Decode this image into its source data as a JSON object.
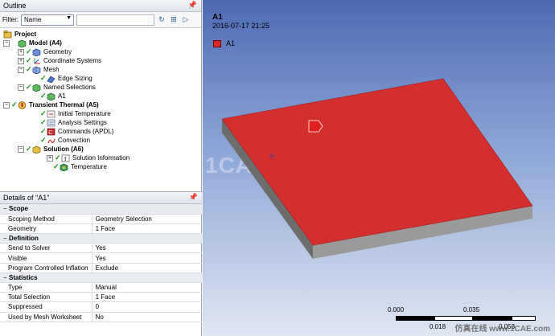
{
  "outline": {
    "title": "Outline",
    "pin": "ё",
    "filter_label": "Filter:",
    "filter_value": "Name",
    "filter_text": "",
    "tree": [
      {
        "label": "Project",
        "bold": true
      },
      {
        "label": "Model (A4)",
        "bold": true
      },
      {
        "label": "Geometry",
        "bold": false
      },
      {
        "label": "Coordinate Systems",
        "bold": false
      },
      {
        "label": "Mesh",
        "bold": false
      },
      {
        "label": "Edge Sizing",
        "bold": false
      },
      {
        "label": "Named Selections",
        "bold": false
      },
      {
        "label": "A1",
        "bold": false
      },
      {
        "label": "Transient Thermal (A5)",
        "bold": true
      },
      {
        "label": "Initial Temperature",
        "bold": false
      },
      {
        "label": "Analysis Settings",
        "bold": false
      },
      {
        "label": "Commands (APDL)",
        "bold": false
      },
      {
        "label": "Convection",
        "bold": false
      },
      {
        "label": "Solution (A6)",
        "bold": true
      },
      {
        "label": "Solution Information",
        "bold": false
      },
      {
        "label": "Temperature",
        "bold": false
      }
    ]
  },
  "details": {
    "title": "Details of \"A1\"",
    "pin": "ё",
    "sections": [
      {
        "name": "Scope",
        "rows": [
          [
            "Scoping Method",
            "Geometry Selection"
          ],
          [
            "Geometry",
            "1 Face"
          ]
        ]
      },
      {
        "name": "Definition",
        "rows": [
          [
            "Send to Solver",
            "Yes"
          ],
          [
            "Visible",
            "Yes"
          ],
          [
            "Program Controlled Inflation",
            "Exclude"
          ]
        ]
      },
      {
        "name": "Statistics",
        "rows": [
          [
            "Type",
            "Manual"
          ],
          [
            "Total Selection",
            "1 Face"
          ],
          [
            "Suppressed",
            "0"
          ],
          [
            "Used by Mesh Worksheet",
            "No"
          ]
        ]
      }
    ]
  },
  "viewport": {
    "title": "A1",
    "date": "2016-07-17 21:25",
    "legend_label": "A1",
    "legend_color": "#d82828",
    "plate_color": "#d42f2f",
    "watermark": "1CAE.COM",
    "scale_labels": {
      "l0": "0.000",
      "l1": "0.018",
      "l2": "0.035",
      "l3": "0.053"
    },
    "site_mark": "仿真在线 www.1CAE.com"
  }
}
